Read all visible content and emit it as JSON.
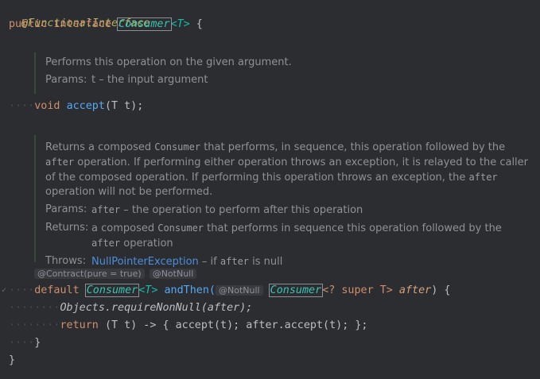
{
  "code": {
    "annotation": "@FunctionalInterface",
    "kw_public": "public",
    "kw_interface": "interface",
    "iface_name": "Consumer",
    "type_params": "<T>",
    "brace_open": " {",
    "accept_void": "void",
    "accept_name": "accept",
    "accept_params": "(T t);",
    "default_kw": "default",
    "and_then_ret": "Consumer",
    "and_then_tparam": "<T>",
    "and_then_name": "andThen(",
    "param_type": "Consumer",
    "param_generic": "<? super T>",
    "param_name": "after",
    "sig_close": ") {",
    "objects_call": "Objects.requireNonNull(after);",
    "return_kw": "return",
    "return_body": "(T t) -> { accept(t); after.accept(t); };",
    "inner_close": "}",
    "outer_close": "}"
  },
  "doc_accept": {
    "text": "Performs this operation on the given argument.",
    "params_label": "Params:",
    "params_value": "t – the input argument"
  },
  "doc_and_then": {
    "desc_1": "Returns a composed ",
    "desc_code1": "Consumer",
    "desc_2": " that performs, in sequence, this operation followed by the ",
    "desc_code2": "after",
    "desc_3": " operation. If performing either operation throws an exception, it is relayed to the caller of the composed operation. If performing this operation throws an exception, the ",
    "desc_code3": "after",
    "desc_4": " operation will not be performed.",
    "params_label": "Params:",
    "params_code": "after",
    "params_text": " – the operation to perform after this operation",
    "returns_label": "Returns:",
    "returns_1": "a composed ",
    "returns_code1": "Consumer",
    "returns_2": " that performs in sequence this operation followed by the ",
    "returns_code2": "after",
    "returns_3": " operation",
    "throws_label": "Throws:",
    "throws_link": "NullPointerException",
    "throws_text_1": " – if ",
    "throws_code": "after",
    "throws_text_2": " is null"
  },
  "hints": {
    "contract": "@Contract(pure = true)",
    "notnull": "@NotNull",
    "param_notnull": "@NotNull"
  }
}
